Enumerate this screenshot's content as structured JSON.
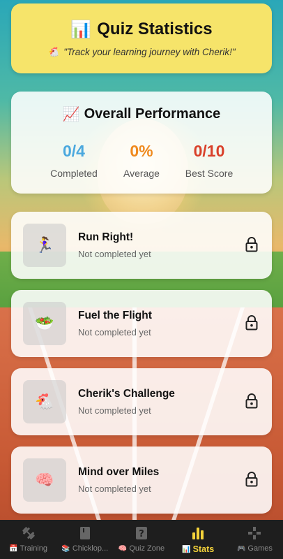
{
  "header": {
    "title_icon": "📊",
    "title": "Quiz Statistics",
    "subtitle_icon": "🐔",
    "subtitle": "\"Track your learning journey with Cherik!\""
  },
  "overall": {
    "title_icon": "📈",
    "title": "Overall Performance",
    "stats": [
      {
        "value": "0/4",
        "label": "Completed",
        "color": "#4aa8de"
      },
      {
        "value": "0%",
        "label": "Average",
        "color": "#ef8a1e"
      },
      {
        "value": "0/10",
        "label": "Best Score",
        "color": "#d9402a"
      }
    ]
  },
  "quizzes": [
    {
      "icon": "🏃‍♀️",
      "title": "Run Right!",
      "status": "Not completed yet"
    },
    {
      "icon": "🥗",
      "title": "Fuel the Flight",
      "status": "Not completed yet"
    },
    {
      "icon": "🐔",
      "title": "Cherik's Challenge",
      "status": "Not completed yet"
    },
    {
      "icon": "🧠",
      "title": "Mind over Miles",
      "status": "Not completed yet"
    }
  ],
  "nav": [
    {
      "icon": "dumbbell-icon",
      "emoji": "📅",
      "label": "Training"
    },
    {
      "icon": "book-icon",
      "emoji": "📚",
      "label": "Chicklop..."
    },
    {
      "icon": "quiz-icon",
      "emoji": "🧠",
      "label": "Quiz Zone"
    },
    {
      "icon": "stats-icon",
      "emoji": "📊",
      "label": "Stats",
      "active": true
    },
    {
      "icon": "gamepad-icon",
      "emoji": "🎮",
      "label": "Games"
    }
  ],
  "colors": {
    "header_bg": "#f6e46a",
    "nav_bg": "#1e1e1e",
    "active": "#f4d23a"
  }
}
